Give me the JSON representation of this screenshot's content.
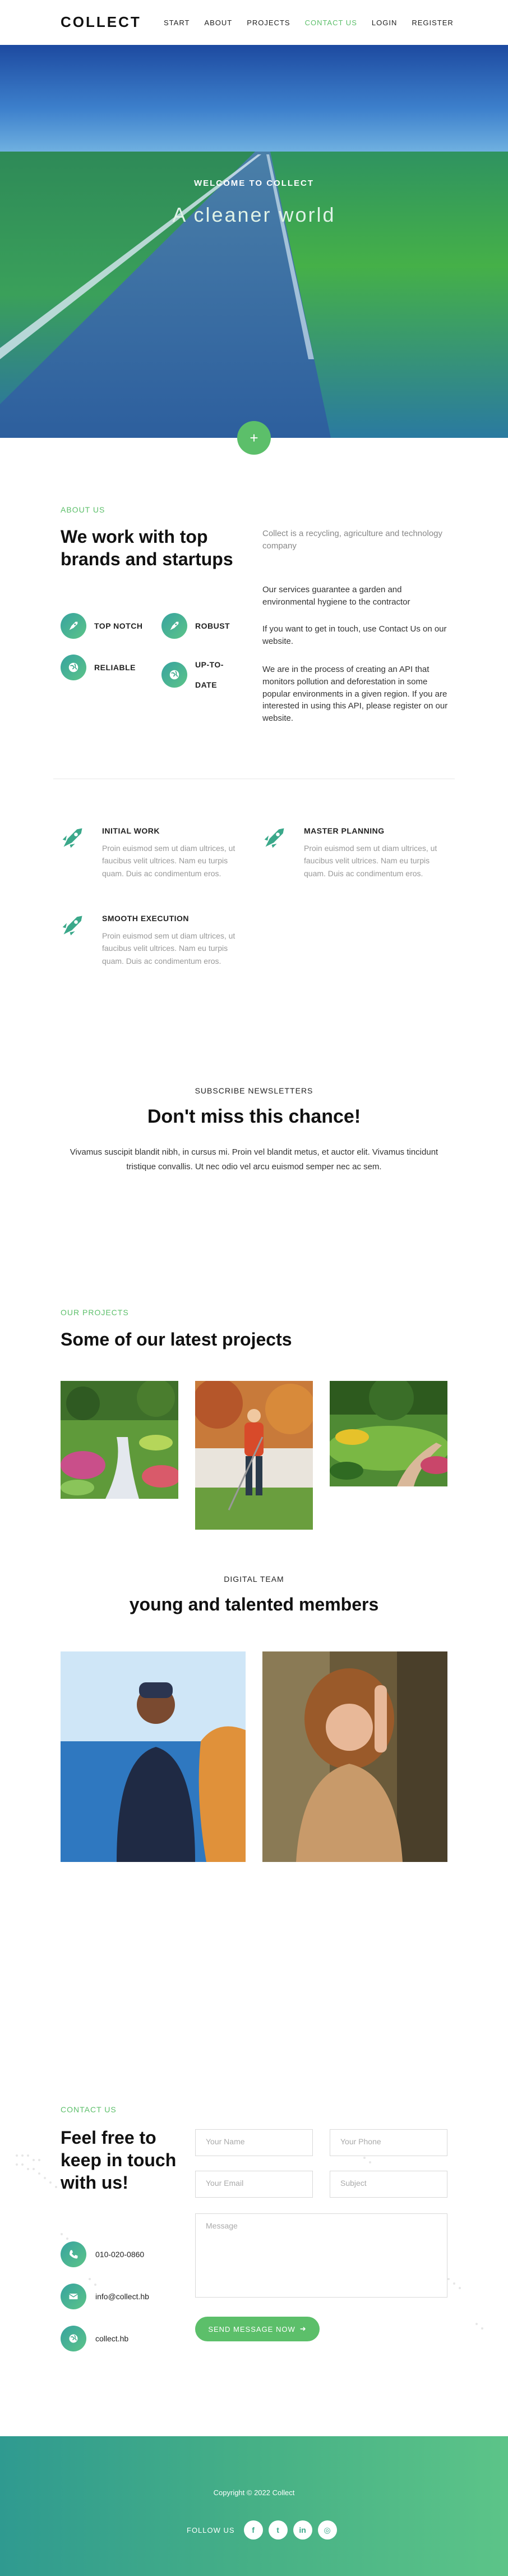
{
  "brand": {
    "logo": "COLLECT",
    "accent": "#5cbf6a"
  },
  "nav": {
    "items": [
      {
        "label": "START",
        "active": false
      },
      {
        "label": "ABOUT",
        "active": false
      },
      {
        "label": "PROJECTS",
        "active": false
      },
      {
        "label": "CONTACT US",
        "active": true
      },
      {
        "label": "LOGIN",
        "active": false
      },
      {
        "label": "REGISTER",
        "active": false
      }
    ]
  },
  "hero": {
    "kicker": "WELCOME TO COLLECT",
    "title": "A cleaner world",
    "button_icon": "plus-icon"
  },
  "about": {
    "kicker": "ABOUT US",
    "heading": "We work with top brands and startups",
    "features": [
      {
        "label": "TOP NOTCH",
        "icon": "rocket-icon"
      },
      {
        "label": "ROBUST",
        "icon": "rocket-icon"
      },
      {
        "label": "RELIABLE",
        "icon": "globe-icon"
      },
      {
        "label": "UP-TO-DATE",
        "icon": "globe-icon"
      }
    ],
    "paragraphs": [
      "Collect is a recycling, agriculture and technology company",
      "Our services guarantee a garden and environmental hygiene to the contractor",
      "If you want to get in touch, use Contact Us on our website.",
      "We are in the process of creating an API that monitors pollution and deforestation in some popular environments in a given region. If you are interested in using this API, please register on our website."
    ]
  },
  "services": [
    {
      "title": "INITIAL WORK",
      "text": "Proin euismod sem ut diam ultrices, ut faucibus velit ultrices. Nam eu turpis quam. Duis ac condimentum eros.",
      "icon": "rocket-icon"
    },
    {
      "title": "MASTER PLANNING",
      "text": "Proin euismod sem ut diam ultrices, ut faucibus velit ultrices. Nam eu turpis quam. Duis ac condimentum eros.",
      "icon": "rocket-icon"
    },
    {
      "title": "SMOOTH EXECUTION",
      "text": "Proin euismod sem ut diam ultrices, ut faucibus velit ultrices. Nam eu turpis quam. Duis ac condimentum eros.",
      "icon": "rocket-icon"
    }
  ],
  "newsletter": {
    "kicker": "SUBSCRIBE NEWSLETTERS",
    "heading": "Don't miss this chance!",
    "text": "Vivamus suscipit blandit nibh, in cursus mi. Proin vel blandit metus, et auctor elit. Vivamus tincidunt tristique convallis. Ut nec odio vel arcu euismod semper nec ac sem."
  },
  "projects": {
    "kicker": "OUR PROJECTS",
    "heading": "Some of our latest projects"
  },
  "team": {
    "kicker": "DIGITAL TEAM",
    "heading": "young and talented members"
  },
  "contact": {
    "kicker": "CONTACT US",
    "heading": "Feel free to keep in touch with us!",
    "phone": "010-020-0860",
    "email": "info@collect.hb",
    "site": "collect.hb",
    "placeholders": {
      "name": "Your Name",
      "phone": "Your Phone",
      "email": "Your Email",
      "subject": "Subject",
      "message": "Message"
    },
    "send_label": "SEND MESSAGE NOW"
  },
  "footer": {
    "copyright": "Copyright © 2022 Collect",
    "follow": "FOLLOW US",
    "social": [
      "facebook-icon",
      "twitter-icon",
      "linkedin-icon",
      "dribbble-icon"
    ]
  }
}
